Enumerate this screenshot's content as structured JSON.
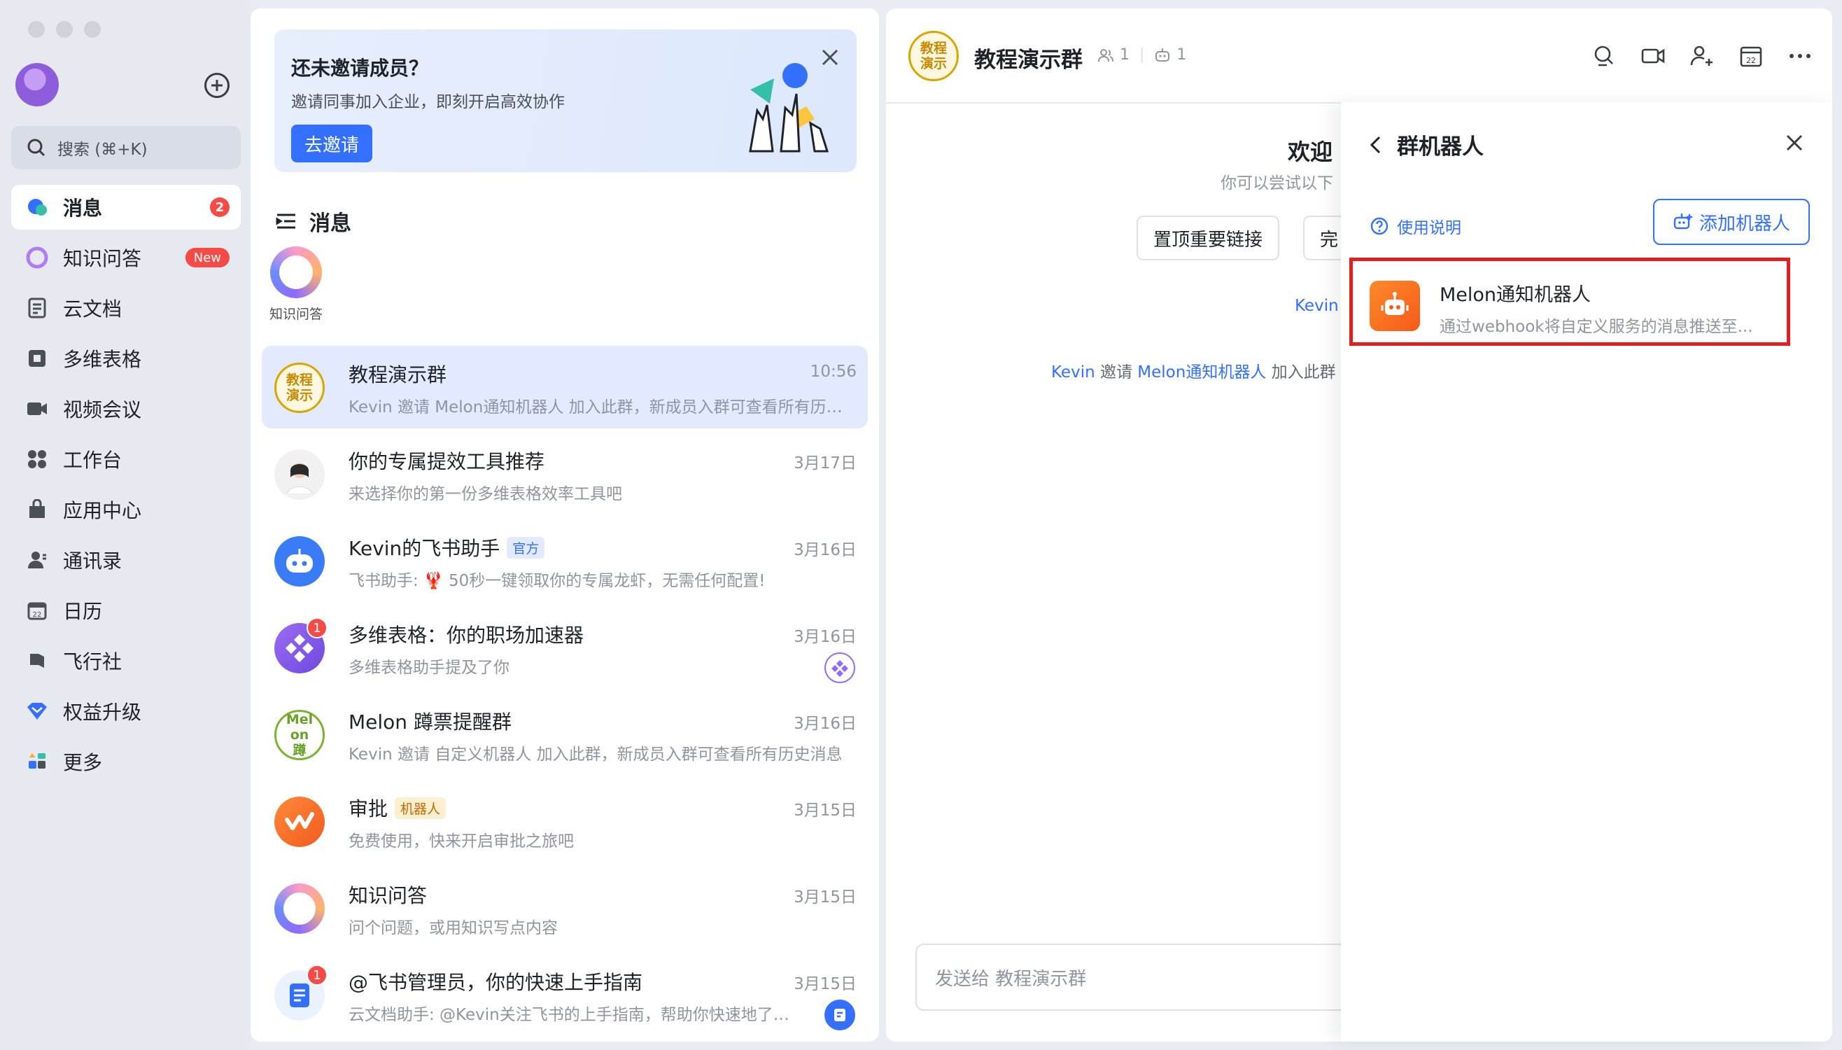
{
  "sidebar": {
    "search_placeholder": "搜索 (⌘+K)",
    "items": [
      {
        "label": "消息",
        "badge": "2",
        "icon": "message-icon"
      },
      {
        "label": "知识问答",
        "badge": "New",
        "icon": "knowledge-qa-icon"
      },
      {
        "label": "云文档",
        "icon": "cloud-docs-icon"
      },
      {
        "label": "多维表格",
        "icon": "base-table-icon"
      },
      {
        "label": "视频会议",
        "icon": "video-meeting-icon"
      },
      {
        "label": "工作台",
        "icon": "workplace-icon"
      },
      {
        "label": "应用中心",
        "icon": "app-center-icon"
      },
      {
        "label": "通讯录",
        "icon": "contacts-icon"
      },
      {
        "label": "日历",
        "icon": "calendar-icon"
      },
      {
        "label": "飞行社",
        "icon": "flight-club-icon"
      },
      {
        "label": "权益升级",
        "icon": "upgrade-icon"
      },
      {
        "label": "更多",
        "icon": "more-apps-icon"
      }
    ]
  },
  "invite_banner": {
    "title": "还未邀请成员？",
    "subtitle": "邀请同事加入企业，即刻开启高效协作",
    "button": "去邀请"
  },
  "list": {
    "header": "消息",
    "pinned_label": "知识问答",
    "conversations": [
      {
        "title": "教程演示群",
        "time": "10:56",
        "preview": "Kevin 邀请 Melon通知机器人 加入此群，新成员入群可查看所有历…",
        "avatar_text": "教程演示"
      },
      {
        "title": "你的专属提效工具推荐",
        "time": "3月17日",
        "preview": "来选择你的第一份多维表格效率工具吧"
      },
      {
        "title": "Kevin的飞书助手",
        "tag": "官方",
        "time": "3月16日",
        "preview": "飞书助手: 🦞 50秒一键领取你的专属龙虾，无需任何配置!"
      },
      {
        "title": "多维表格：你的职场加速器",
        "time": "3月16日",
        "preview": "多维表格助手提及了你",
        "badge": "1"
      },
      {
        "title": "Melon 蹲票提醒群",
        "time": "3月16日",
        "preview": "Kevin 邀请 自定义机器人 加入此群，新成员入群可查看所有历史消息",
        "avatar_text": "Melon蹲"
      },
      {
        "title": "审批",
        "tag": "机器人",
        "time": "3月15日",
        "preview": "免费使用，快来开启审批之旅吧"
      },
      {
        "title": "知识问答",
        "time": "3月15日",
        "preview": "问个问题，或用知识写点内容"
      },
      {
        "title": "@飞书管理员，你的快速上手指南",
        "time": "3月15日",
        "preview": "云文档助手: @Kevin关注飞书的上手指南，帮助你快速地了…",
        "badge": "1"
      }
    ]
  },
  "chat": {
    "title": "教程演示群",
    "avatar_text": "教程演示",
    "member_count": "1",
    "bot_count": "1",
    "welcome": "欢迎",
    "welcome_sub": "你可以尝试以下",
    "quick_actions": [
      "置顶重要链接",
      "完"
    ],
    "sys_user": "Kevin",
    "sys_line": {
      "actor": "Kevin",
      "verb": "邀请",
      "target": "Melon通知机器人",
      "tail": "加入此群"
    },
    "composer_placeholder": "发送给 教程演示群"
  },
  "bots_panel": {
    "title": "群机器人",
    "help": "使用说明",
    "add_button": "添加机器人",
    "bot": {
      "name": "Melon通知机器人",
      "desc": "通过webhook将自定义服务的消息推送至..."
    }
  },
  "colors": {
    "accent": "#3370ff",
    "badge": "#f54a45",
    "highlight_border": "#e02020"
  }
}
